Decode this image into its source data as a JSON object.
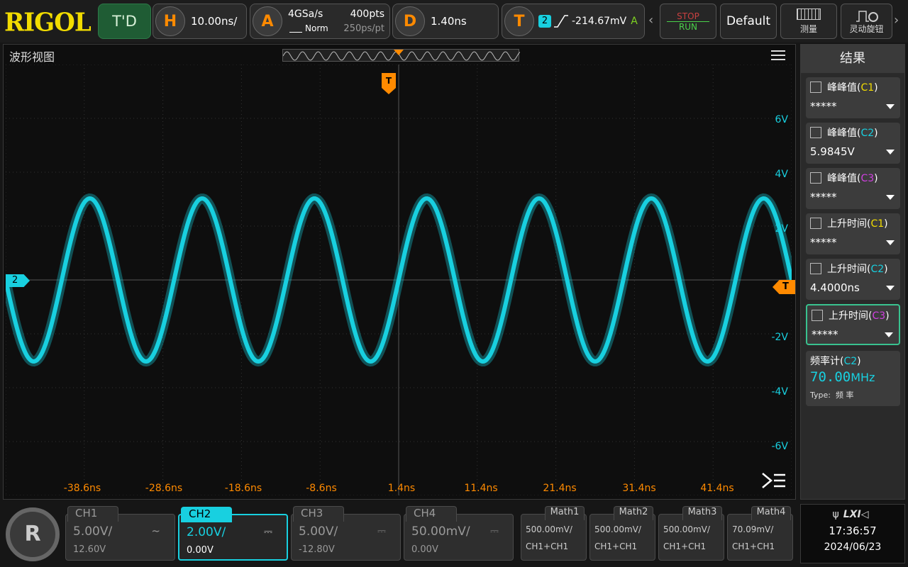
{
  "brand": "RIGOL",
  "top": {
    "trigger_mode": "T'D",
    "h_label": "H",
    "timebase": "10.00ns/",
    "a_label": "A",
    "sample_rate": "4GSa/s",
    "points": "400pts",
    "acq_mode": "Norm",
    "sample_interval": "250ps/pt",
    "d_label": "D",
    "delay": "1.40ns",
    "t_label": "T",
    "trig_source": "2",
    "trig_level": "-214.67mV",
    "trig_coupling": "A",
    "stop_label": "STOP",
    "run_label": "RUN",
    "default_label": "Default",
    "measure_label": "测量",
    "knob_label": "灵动旋钮"
  },
  "waveform": {
    "title": "波形视图",
    "trigger_marker": "T",
    "channel_marker": "2",
    "x_labels": [
      "-38.6ns",
      "-28.6ns",
      "-18.6ns",
      "-8.6ns",
      "1.4ns",
      "11.4ns",
      "21.4ns",
      "31.4ns",
      "41.4ns"
    ],
    "y_labels": [
      "6V",
      "4V",
      "2V",
      "-2V",
      "-4V",
      "-6V"
    ],
    "trace_color": "#18d0e0",
    "trigger_color": "#ff8a00"
  },
  "results": {
    "title": "结果",
    "items": [
      {
        "name": "峰峰值",
        "ch": "C1",
        "value": "*****"
      },
      {
        "name": "峰峰值",
        "ch": "C2",
        "value": "5.9845V"
      },
      {
        "name": "峰峰值",
        "ch": "C3",
        "value": "*****"
      },
      {
        "name": "上升时间",
        "ch": "C1",
        "value": "*****"
      },
      {
        "name": "上升时间",
        "ch": "C2",
        "value": "4.4000ns"
      },
      {
        "name": "上升时间",
        "ch": "C3",
        "value": "*****"
      }
    ],
    "counter": {
      "name": "频率计",
      "ch": "C2",
      "value": "70.00",
      "unit": "MHz",
      "type_label": "Type:",
      "type_value": "频 率"
    }
  },
  "channels": [
    {
      "name": "CH1",
      "scale": "5.00V/",
      "offset": "12.60V",
      "coupling": "~"
    },
    {
      "name": "CH2",
      "scale": "2.00V/",
      "offset": "0.00V",
      "coupling": "⎓"
    },
    {
      "name": "CH3",
      "scale": "5.00V/",
      "offset": "-12.80V",
      "coupling": "⎓"
    },
    {
      "name": "CH4",
      "scale": "50.00mV/",
      "offset": "0.00V",
      "coupling": "⎓"
    }
  ],
  "math": [
    {
      "name": "Math1",
      "scale": "500.00mV/",
      "expr": "CH1+CH1"
    },
    {
      "name": "Math2",
      "scale": "500.00mV/",
      "expr": "CH1+CH1"
    },
    {
      "name": "Math3",
      "scale": "500.00mV/",
      "expr": "CH1+CH1"
    },
    {
      "name": "Math4",
      "scale": "70.09mV/",
      "expr": "CH1+CH1"
    }
  ],
  "status": {
    "lxi": "LXI",
    "time": "17:36:57",
    "date": "2024/06/23"
  }
}
